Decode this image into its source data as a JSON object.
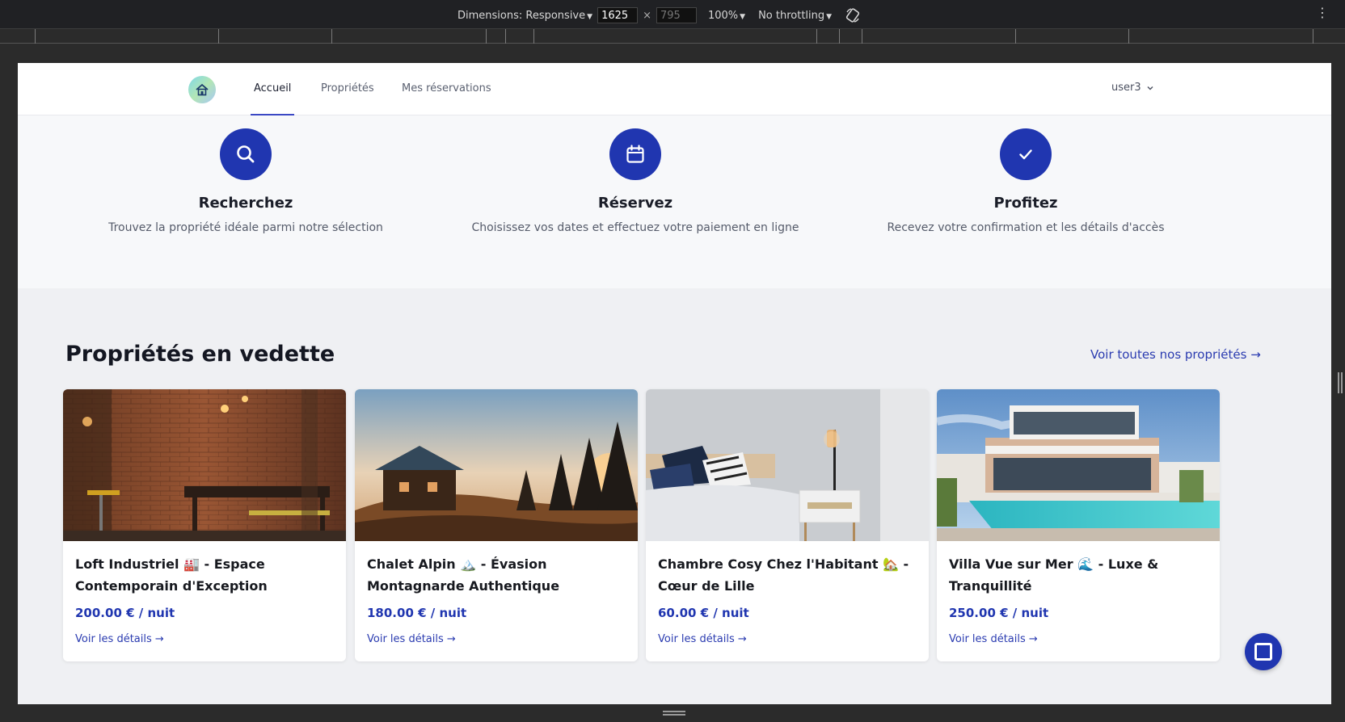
{
  "devtools": {
    "dimensions_label": "Dimensions: Responsive",
    "width_value": "1625",
    "height_value": "795",
    "times_sign": "×",
    "zoom": "100%",
    "throttling": "No throttling",
    "icons": [
      "caret-down-icon",
      "rotate-icon",
      "more-vert-icon"
    ]
  },
  "navbar": {
    "logo_icon": "house-logo-icon",
    "links": [
      {
        "label": "Accueil",
        "active": true
      },
      {
        "label": "Propriétés",
        "active": false
      },
      {
        "label": "Mes réservations",
        "active": false
      }
    ],
    "user": "user3",
    "accent_color": "#3b48c4"
  },
  "steps": [
    {
      "icon": "search-icon",
      "title": "Recherchez",
      "text": "Trouvez la propriété idéale parmi notre sélection"
    },
    {
      "icon": "calendar-icon",
      "title": "Réservez",
      "text": "Choisissez vos dates et effectuez votre paiement en ligne"
    },
    {
      "icon": "check-icon",
      "title": "Profitez",
      "text": "Recevez votre confirmation et les détails d'accès"
    }
  ],
  "featured": {
    "heading": "Propriétés en vedette",
    "see_all": "Voir toutes nos propriétés →",
    "cards": [
      {
        "title": "Loft Industriel 🏭 - Espace Contemporain d'Exception",
        "price": "200.00 € / nuit",
        "link": "Voir les détails →",
        "photo": "industrial-loft-photo"
      },
      {
        "title": "Chalet Alpin 🏔️ - Évasion Montagnarde Authentique",
        "price": "180.00 € / nuit",
        "link": "Voir les détails →",
        "photo": "alpine-chalet-photo"
      },
      {
        "title": "Chambre Cosy Chez l'Habitant 🏡 - Cœur de Lille",
        "price": "60.00 € / nuit",
        "link": "Voir les détails →",
        "photo": "cosy-bedroom-photo"
      },
      {
        "title": "Villa Vue sur Mer 🌊 - Luxe & Tranquillité",
        "price": "250.00 € / nuit",
        "link": "Voir les détails →",
        "photo": "sea-view-villa-photo"
      }
    ]
  },
  "colors": {
    "primary": "#2036b0",
    "steps_bg": "#f7f8fa",
    "featured_bg": "#eff0f3"
  },
  "chat_icon": "chat-icon"
}
